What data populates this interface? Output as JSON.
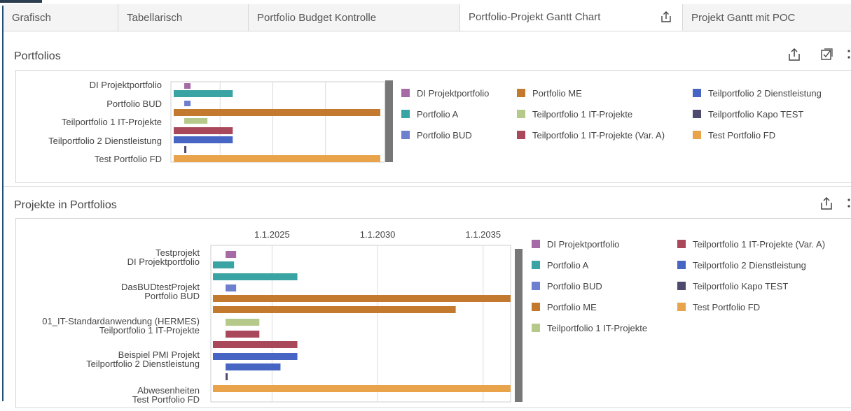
{
  "tabs": [
    {
      "label": "Grafisch"
    },
    {
      "label": "Tabellarisch"
    },
    {
      "label": "Portfolio Budget Kontrolle"
    },
    {
      "label": "Portfolio-Projekt Gantt Chart"
    },
    {
      "label": "Projekt Gantt mit POC"
    }
  ],
  "active_tab": "Portfolio-Projekt Gantt Chart",
  "icons": {
    "tab_share": "share-icon",
    "export": "share-icon",
    "checkbox": "checkbox-icon",
    "more": "more-vertical-icon"
  },
  "colors": {
    "DI Projektportfolio": "#a66ba6",
    "Portfolio A": "#3aa3a3",
    "Portfolio BUD": "#6f7fcf",
    "Portfolio ME": "#c47a2e",
    "Teilportfolio 1 IT-Projekte": "#b5c98b",
    "Teilportfolio 1 IT-Projekte (Var. A)": "#a8485a",
    "Teilportfolio 2 Dienstleistung": "#4766c4",
    "Teilportfolio Kapo TEST": "#4d4a6e",
    "Test Portfolio FD": "#e8a34b"
  },
  "portfolios": {
    "title": "Portfolios",
    "legend": [
      "DI Projektportfolio",
      "Portfolio ME",
      "Teilportfolio 2 Dienstleistung",
      "Portfolio A",
      "Teilportfolio 1 IT-Projekte",
      "Teilportfolio Kapo TEST",
      "Portfolio BUD",
      "Teilportfolio 1 IT-Projekte (Var. A)",
      "Test Portfolio FD"
    ]
  },
  "projects": {
    "title": "Projekte in Portfolios",
    "legend": [
      "DI Projektportfolio",
      "Teilportfolio 1 IT-Projekte (Var. A)",
      "Portfolio A",
      "Teilportfolio 2 Dienstleistung",
      "Portfolio BUD",
      "Teilportfolio Kapo TEST",
      "Portfolio ME",
      "Test Portfolio FD",
      "Teilportfolio 1 IT-Projekte"
    ]
  },
  "chart_data": [
    {
      "type": "bar",
      "orientation": "gantt",
      "title": "Portfolios",
      "categories": [
        "DI Projektportfolio",
        "Portfolio BUD",
        "Teilportfolio 1 IT-Projekte",
        "Teilportfolio 2 Dienstleistung",
        "Test Portfolio FD"
      ],
      "x_unit": "year",
      "xlim": [
        2020.6,
        2040.2
      ],
      "ticks": [
        2025,
        2030,
        2035
      ],
      "tick_labels_shown": false,
      "grid": true,
      "bars": [
        {
          "series": "DI Projektportfolio",
          "start": 2021.6,
          "end": 2022.2
        },
        {
          "series": "Portfolio A",
          "start": 2020.6,
          "end": 2026.2
        },
        {
          "series": "Portfolio BUD",
          "start": 2021.6,
          "end": 2022.2
        },
        {
          "series": "Portfolio ME",
          "start": 2020.6,
          "end": 2040.2
        },
        {
          "series": "Teilportfolio 1 IT-Projekte",
          "start": 2021.6,
          "end": 2023.8
        },
        {
          "series": "Teilportfolio 1 IT-Projekte (Var. A)",
          "start": 2020.6,
          "end": 2026.2
        },
        {
          "series": "Teilportfolio 2 Dienstleistung",
          "start": 2020.6,
          "end": 2026.2
        },
        {
          "series": "Teilportfolio Kapo TEST",
          "start": 2021.6,
          "end": 2021.8
        },
        {
          "series": "Test Portfolio FD",
          "start": 2020.6,
          "end": 2040.2
        }
      ],
      "legend_position": "right"
    },
    {
      "type": "bar",
      "orientation": "gantt",
      "title": "Projekte in Portfolios",
      "groups": [
        {
          "line1": "Testprojekt",
          "line2": "DI Projektportfolio"
        },
        {
          "line1": "DasBUDtestProjekt",
          "line2": "Portfolio BUD"
        },
        {
          "line1": "01_IT-Standardanwendung (HERMES)",
          "line2": "Teilportfolio 1 IT-Projekte"
        },
        {
          "line1": "Beispiel PMI Projekt",
          "line2": "Teilportfolio 2 Dienstleistung"
        },
        {
          "line1": "Abwesenheiten",
          "line2": "Test Portfolio FD"
        }
      ],
      "x_unit": "date",
      "xlim": [
        "2022-03-01",
        "2036-08-01"
      ],
      "tick_labels": [
        "1.1.2025",
        "1.1.2030",
        "1.1.2035"
      ],
      "ticks": [
        2025,
        2030,
        2035
      ],
      "grid": true,
      "bars": [
        {
          "series": "DI Projektportfolio",
          "start": 2022.8,
          "end": 2023.3
        },
        {
          "series": "Portfolio A",
          "start": 2022.2,
          "end": 2023.2
        },
        {
          "series": "Portfolio A",
          "start": 2022.2,
          "end": 2026.2
        },
        {
          "series": "Portfolio BUD",
          "start": 2022.8,
          "end": 2023.3
        },
        {
          "series": "Portfolio ME",
          "start": 2022.2,
          "end": 2036.3
        },
        {
          "series": "Portfolio ME",
          "start": 2022.2,
          "end": 2033.7
        },
        {
          "series": "Teilportfolio 1 IT-Projekte",
          "start": 2022.8,
          "end": 2024.4
        },
        {
          "series": "Teilportfolio 1 IT-Projekte (Var. A)",
          "start": 2022.8,
          "end": 2024.4
        },
        {
          "series": "Teilportfolio 1 IT-Projekte (Var. A)",
          "start": 2022.2,
          "end": 2026.2
        },
        {
          "series": "Teilportfolio 2 Dienstleistung",
          "start": 2022.2,
          "end": 2026.2
        },
        {
          "series": "Teilportfolio 2 Dienstleistung",
          "start": 2022.8,
          "end": 2025.4
        },
        {
          "series": "Teilportfolio Kapo TEST",
          "start": 2022.8,
          "end": 2022.9
        },
        {
          "series": "Test Portfolio FD",
          "start": 2022.2,
          "end": 2036.3
        }
      ],
      "legend_position": "right"
    }
  ]
}
